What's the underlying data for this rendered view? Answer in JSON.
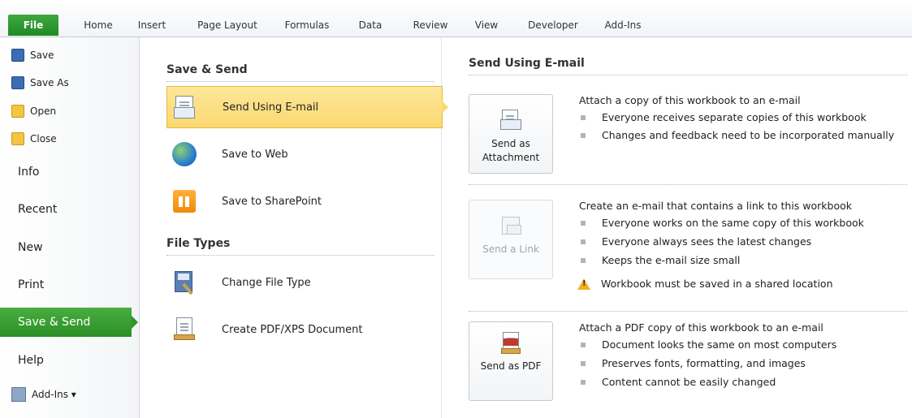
{
  "ribbon": {
    "tabs": [
      "File",
      "Home",
      "Insert",
      "Page Layout",
      "Formulas",
      "Data",
      "Review",
      "View",
      "Developer",
      "Add-Ins"
    ]
  },
  "leftnav": {
    "small_items": [
      {
        "label": "Save",
        "icon": "save-icon"
      },
      {
        "label": "Save As",
        "icon": "save-as-icon"
      },
      {
        "label": "Open",
        "icon": "open-folder-icon"
      },
      {
        "label": "Close",
        "icon": "close-folder-icon"
      }
    ],
    "big_items": [
      "Info",
      "Recent",
      "New",
      "Print",
      "Save & Send",
      "Help"
    ],
    "active": "Save & Send",
    "addins_label": "Add-Ins ▾"
  },
  "middle": {
    "save_send_header": "Save & Send",
    "save_send_items": [
      {
        "label": "Send Using E-mail",
        "icon": "email-icon"
      },
      {
        "label": "Save to Web",
        "icon": "globe-icon"
      },
      {
        "label": "Save to SharePoint",
        "icon": "sharepoint-icon"
      }
    ],
    "file_types_header": "File Types",
    "file_types_items": [
      {
        "label": "Change File Type",
        "icon": "change-file-type-icon"
      },
      {
        "label": "Create PDF/XPS Document",
        "icon": "pdf-xps-icon"
      }
    ]
  },
  "right": {
    "header": "Send Using E-mail",
    "options": [
      {
        "button_label": "Send as Attachment",
        "title": "Attach a copy of this workbook to an e-mail",
        "bullets": [
          "Everyone receives separate copies of this workbook",
          "Changes and feedback need to be incorporated manually"
        ]
      },
      {
        "button_label": "Send a Link",
        "title": "Create an e-mail that contains a link to this workbook",
        "bullets": [
          "Everyone works on the same copy of this workbook",
          "Everyone always sees the latest changes",
          "Keeps the e-mail size small"
        ],
        "warning": "Workbook must be saved in a shared location"
      },
      {
        "button_label": "Send as PDF",
        "title": "Attach a PDF copy of this workbook to an e-mail",
        "bullets": [
          "Document looks the same on most computers",
          "Preserves fonts, formatting, and images",
          "Content cannot be easily changed"
        ]
      }
    ]
  },
  "colors": {
    "file_green": "#2a8f26",
    "selected_yellow": "#fcd871",
    "warning_amber": "#f2b01e"
  }
}
